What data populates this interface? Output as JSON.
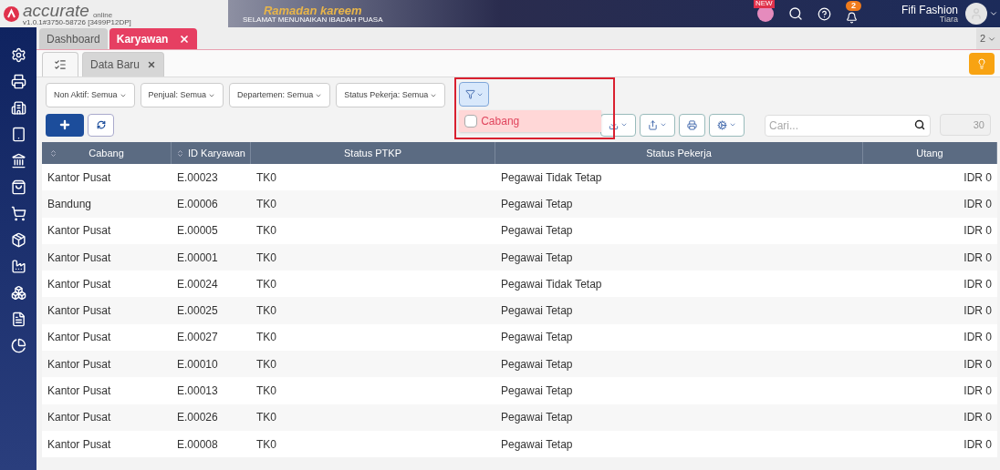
{
  "header": {
    "logo": "accurate",
    "logo_sub": "online",
    "version": "v1.0.1#3750-58726 [3499P12DP]",
    "banner_title": "Ramadan kareem",
    "banner_sub": "SELAMAT MENUNAIKAN IBADAH PUASA",
    "new_badge": "NEW",
    "notification_count": "2",
    "company": "Fifi Fashion",
    "user": "Tiara"
  },
  "tabs": [
    {
      "label": "Dashboard",
      "selected": false
    },
    {
      "label": "Karyawan",
      "selected": true
    }
  ],
  "tab_count": "2",
  "sub_tabs": [
    {
      "kind": "list",
      "selected": true
    },
    {
      "kind": "form",
      "label": "Data Baru",
      "selected": false
    }
  ],
  "filters": [
    "Non Aktif: Semua",
    "Penjual: Semua",
    "Departemen: Semua",
    "Status Pekerja: Semua"
  ],
  "filter_menu": {
    "expanded": true,
    "items": [
      {
        "label": "Cabang",
        "checked": false
      }
    ]
  },
  "search": {
    "placeholder": "Cari..."
  },
  "page_size": "30",
  "table": {
    "columns": [
      {
        "label": "Cabang",
        "sortable": true
      },
      {
        "label": "ID Karyawan",
        "sortable": true
      },
      {
        "label": "Status PTKP",
        "sortable": false
      },
      {
        "label": "Status Pekerja",
        "sortable": false
      },
      {
        "label": "Utang",
        "sortable": false
      }
    ],
    "rows": [
      [
        "Kantor Pusat",
        "E.00023",
        "TK0",
        "Pegawai Tidak Tetap",
        "IDR 0"
      ],
      [
        "Bandung",
        "E.00006",
        "TK0",
        "Pegawai Tetap",
        "IDR 0"
      ],
      [
        "Kantor Pusat",
        "E.00005",
        "TK0",
        "Pegawai Tetap",
        "IDR 0"
      ],
      [
        "Kantor Pusat",
        "E.00001",
        "TK0",
        "Pegawai Tetap",
        "IDR 0"
      ],
      [
        "Kantor Pusat",
        "E.00024",
        "TK0",
        "Pegawai Tidak Tetap",
        "IDR 0"
      ],
      [
        "Kantor Pusat",
        "E.00025",
        "TK0",
        "Pegawai Tetap",
        "IDR 0"
      ],
      [
        "Kantor Pusat",
        "E.00027",
        "TK0",
        "Pegawai Tetap",
        "IDR 0"
      ],
      [
        "Kantor Pusat",
        "E.00010",
        "TK0",
        "Pegawai Tetap",
        "IDR 0"
      ],
      [
        "Kantor Pusat",
        "E.00013",
        "TK0",
        "Pegawai Tetap",
        "IDR 0"
      ],
      [
        "Kantor Pusat",
        "E.00026",
        "TK0",
        "Pegawai Tetap",
        "IDR 0"
      ],
      [
        "Kantor Pusat",
        "E.00008",
        "TK0",
        "Pegawai Tetap",
        "IDR 0"
      ]
    ]
  }
}
